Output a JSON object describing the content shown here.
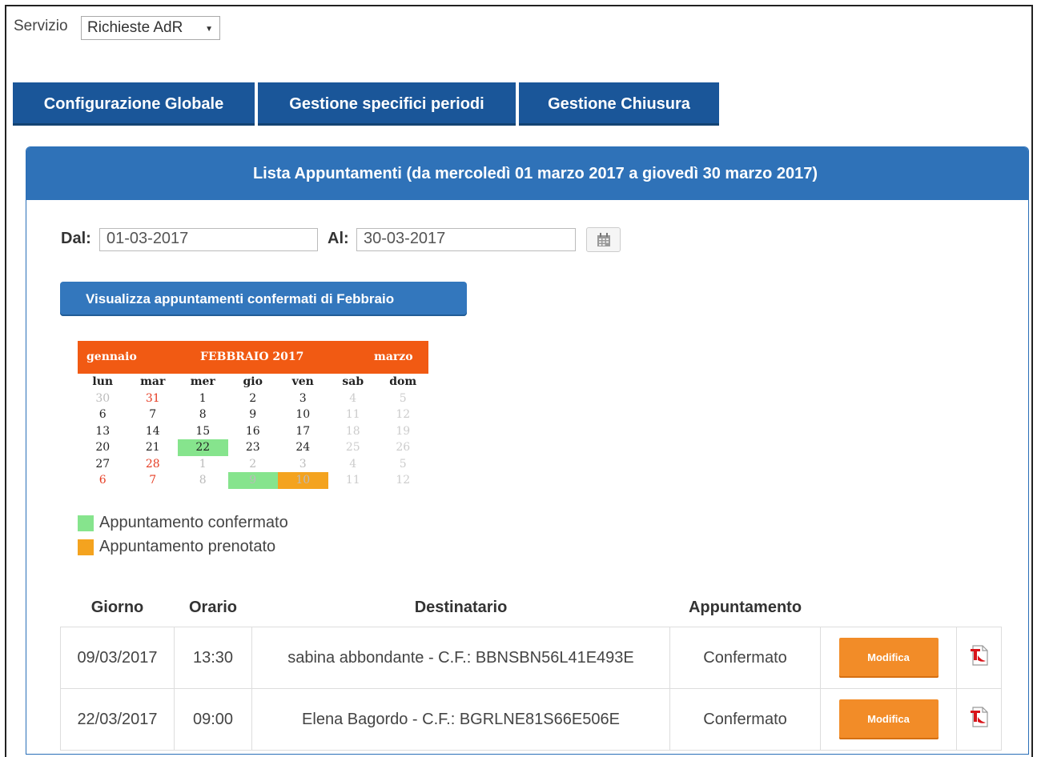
{
  "service": {
    "label": "Servizio",
    "selected": "Richieste AdR"
  },
  "tabs": [
    "Configurazione Globale",
    "Gestione specifici periodi",
    "Gestione Chiusura"
  ],
  "panel_title": "Lista Appuntamenti (da mercoledì 01 marzo 2017 a giovedì 30 marzo 2017)",
  "filter": {
    "dal_label": "Dal:",
    "dal_value": "01-03-2017",
    "al_label": "Al:",
    "al_value": "30-03-2017"
  },
  "show_button": "Visualizza appuntamenti confermati di Febbraio",
  "calendar": {
    "prev": "gennaio",
    "title": "FEBBRAIO 2017",
    "next": "marzo",
    "weekdays": [
      "lun",
      "mar",
      "mer",
      "gio",
      "ven",
      "sab",
      "dom"
    ],
    "weeks": [
      [
        "30",
        "31",
        "1",
        "2",
        "3",
        "4",
        "5"
      ],
      [
        "6",
        "7",
        "8",
        "9",
        "10",
        "11",
        "12"
      ],
      [
        "13",
        "14",
        "15",
        "16",
        "17",
        "18",
        "19"
      ],
      [
        "20",
        "21",
        "22",
        "23",
        "24",
        "25",
        "26"
      ],
      [
        "27",
        "28",
        "1",
        "2",
        "3",
        "4",
        "5"
      ],
      [
        "6",
        "7",
        "8",
        "9",
        "10",
        "11",
        "12"
      ]
    ],
    "highlights": {
      "confirmed": [
        "22 febbraio",
        "9 marzo"
      ],
      "booked": [
        "10 marzo"
      ]
    }
  },
  "legend": {
    "confirmed": "Appuntamento confermato",
    "booked": "Appuntamento prenotato"
  },
  "colors": {
    "tab": "#1a5699",
    "panel": "#2f72b8",
    "calendar_header": "#f15a13",
    "confirmed": "#86e48d",
    "booked": "#f4a31f",
    "modifica": "#f28c28"
  },
  "table": {
    "headers": [
      "Giorno",
      "Orario",
      "Destinatario",
      "Appuntamento"
    ],
    "rows": [
      {
        "giorno": "09/03/2017",
        "orario": "13:30",
        "destinatario": "sabina abbondante - C.F.: BBNSBN56L41E493E",
        "stato": "Confermato",
        "azione": "Modifica",
        "icon": "pdf-icon"
      },
      {
        "giorno": "22/03/2017",
        "orario": "09:00",
        "destinatario": "Elena Bagordo - C.F.: BGRLNE81S66E506E",
        "stato": "Confermato",
        "azione": "Modifica",
        "icon": "pdf-icon"
      }
    ]
  }
}
